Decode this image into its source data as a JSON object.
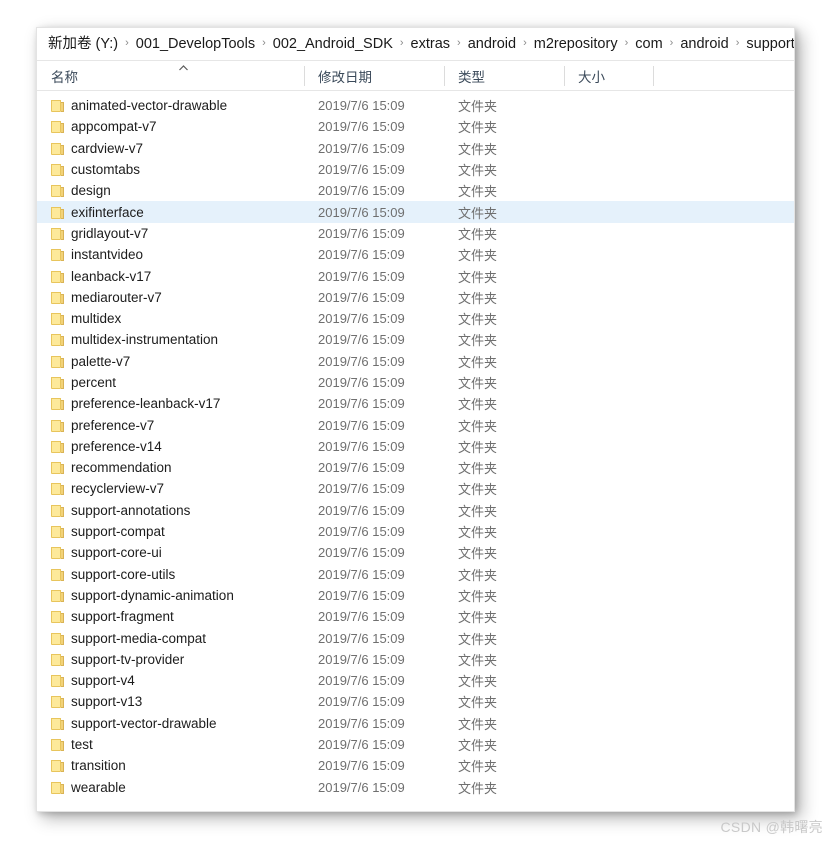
{
  "window": {
    "kind": "windows-file-explorer"
  },
  "addressbar": {
    "crumbs": [
      "新加卷 (Y:)",
      "001_DevelopTools",
      "002_Android_SDK",
      "extras",
      "android",
      "m2repository",
      "com",
      "android",
      "support"
    ],
    "separator": "›"
  },
  "columns": {
    "name": "名称",
    "date": "修改日期",
    "type": "类型",
    "size": "大小",
    "sort_indicator": "▲",
    "sorted_by": "名称",
    "sort_direction": "ascending"
  },
  "files": [
    {
      "name": "animated-vector-drawable",
      "date": "2019/7/6 15:09",
      "type": "文件夹",
      "size": "",
      "selected": false
    },
    {
      "name": "appcompat-v7",
      "date": "2019/7/6 15:09",
      "type": "文件夹",
      "size": "",
      "selected": false
    },
    {
      "name": "cardview-v7",
      "date": "2019/7/6 15:09",
      "type": "文件夹",
      "size": "",
      "selected": false
    },
    {
      "name": "customtabs",
      "date": "2019/7/6 15:09",
      "type": "文件夹",
      "size": "",
      "selected": false
    },
    {
      "name": "design",
      "date": "2019/7/6 15:09",
      "type": "文件夹",
      "size": "",
      "selected": false
    },
    {
      "name": "exifinterface",
      "date": "2019/7/6 15:09",
      "type": "文件夹",
      "size": "",
      "selected": true
    },
    {
      "name": "gridlayout-v7",
      "date": "2019/7/6 15:09",
      "type": "文件夹",
      "size": "",
      "selected": false
    },
    {
      "name": "instantvideo",
      "date": "2019/7/6 15:09",
      "type": "文件夹",
      "size": "",
      "selected": false
    },
    {
      "name": "leanback-v17",
      "date": "2019/7/6 15:09",
      "type": "文件夹",
      "size": "",
      "selected": false
    },
    {
      "name": "mediarouter-v7",
      "date": "2019/7/6 15:09",
      "type": "文件夹",
      "size": "",
      "selected": false
    },
    {
      "name": "multidex",
      "date": "2019/7/6 15:09",
      "type": "文件夹",
      "size": "",
      "selected": false
    },
    {
      "name": "multidex-instrumentation",
      "date": "2019/7/6 15:09",
      "type": "文件夹",
      "size": "",
      "selected": false
    },
    {
      "name": "palette-v7",
      "date": "2019/7/6 15:09",
      "type": "文件夹",
      "size": "",
      "selected": false
    },
    {
      "name": "percent",
      "date": "2019/7/6 15:09",
      "type": "文件夹",
      "size": "",
      "selected": false
    },
    {
      "name": "preference-leanback-v17",
      "date": "2019/7/6 15:09",
      "type": "文件夹",
      "size": "",
      "selected": false
    },
    {
      "name": "preference-v7",
      "date": "2019/7/6 15:09",
      "type": "文件夹",
      "size": "",
      "selected": false
    },
    {
      "name": "preference-v14",
      "date": "2019/7/6 15:09",
      "type": "文件夹",
      "size": "",
      "selected": false
    },
    {
      "name": "recommendation",
      "date": "2019/7/6 15:09",
      "type": "文件夹",
      "size": "",
      "selected": false
    },
    {
      "name": "recyclerview-v7",
      "date": "2019/7/6 15:09",
      "type": "文件夹",
      "size": "",
      "selected": false
    },
    {
      "name": "support-annotations",
      "date": "2019/7/6 15:09",
      "type": "文件夹",
      "size": "",
      "selected": false
    },
    {
      "name": "support-compat",
      "date": "2019/7/6 15:09",
      "type": "文件夹",
      "size": "",
      "selected": false
    },
    {
      "name": "support-core-ui",
      "date": "2019/7/6 15:09",
      "type": "文件夹",
      "size": "",
      "selected": false
    },
    {
      "name": "support-core-utils",
      "date": "2019/7/6 15:09",
      "type": "文件夹",
      "size": "",
      "selected": false
    },
    {
      "name": "support-dynamic-animation",
      "date": "2019/7/6 15:09",
      "type": "文件夹",
      "size": "",
      "selected": false
    },
    {
      "name": "support-fragment",
      "date": "2019/7/6 15:09",
      "type": "文件夹",
      "size": "",
      "selected": false
    },
    {
      "name": "support-media-compat",
      "date": "2019/7/6 15:09",
      "type": "文件夹",
      "size": "",
      "selected": false
    },
    {
      "name": "support-tv-provider",
      "date": "2019/7/6 15:09",
      "type": "文件夹",
      "size": "",
      "selected": false
    },
    {
      "name": "support-v4",
      "date": "2019/7/6 15:09",
      "type": "文件夹",
      "size": "",
      "selected": false
    },
    {
      "name": "support-v13",
      "date": "2019/7/6 15:09",
      "type": "文件夹",
      "size": "",
      "selected": false
    },
    {
      "name": "support-vector-drawable",
      "date": "2019/7/6 15:09",
      "type": "文件夹",
      "size": "",
      "selected": false
    },
    {
      "name": "test",
      "date": "2019/7/6 15:09",
      "type": "文件夹",
      "size": "",
      "selected": false
    },
    {
      "name": "transition",
      "date": "2019/7/6 15:09",
      "type": "文件夹",
      "size": "",
      "selected": false
    },
    {
      "name": "wearable",
      "date": "2019/7/6 15:09",
      "type": "文件夹",
      "size": "",
      "selected": false
    }
  ],
  "watermark": {
    "text": "CSDN @韩曙亮"
  },
  "colors": {
    "selection": "#e5f1fb",
    "folder_fill": "#fde99a",
    "folder_edge": "#e8c55c",
    "name_text": "#1c1c1c",
    "meta_text": "#6f6f6f",
    "header_text": "#3b4a5a"
  }
}
